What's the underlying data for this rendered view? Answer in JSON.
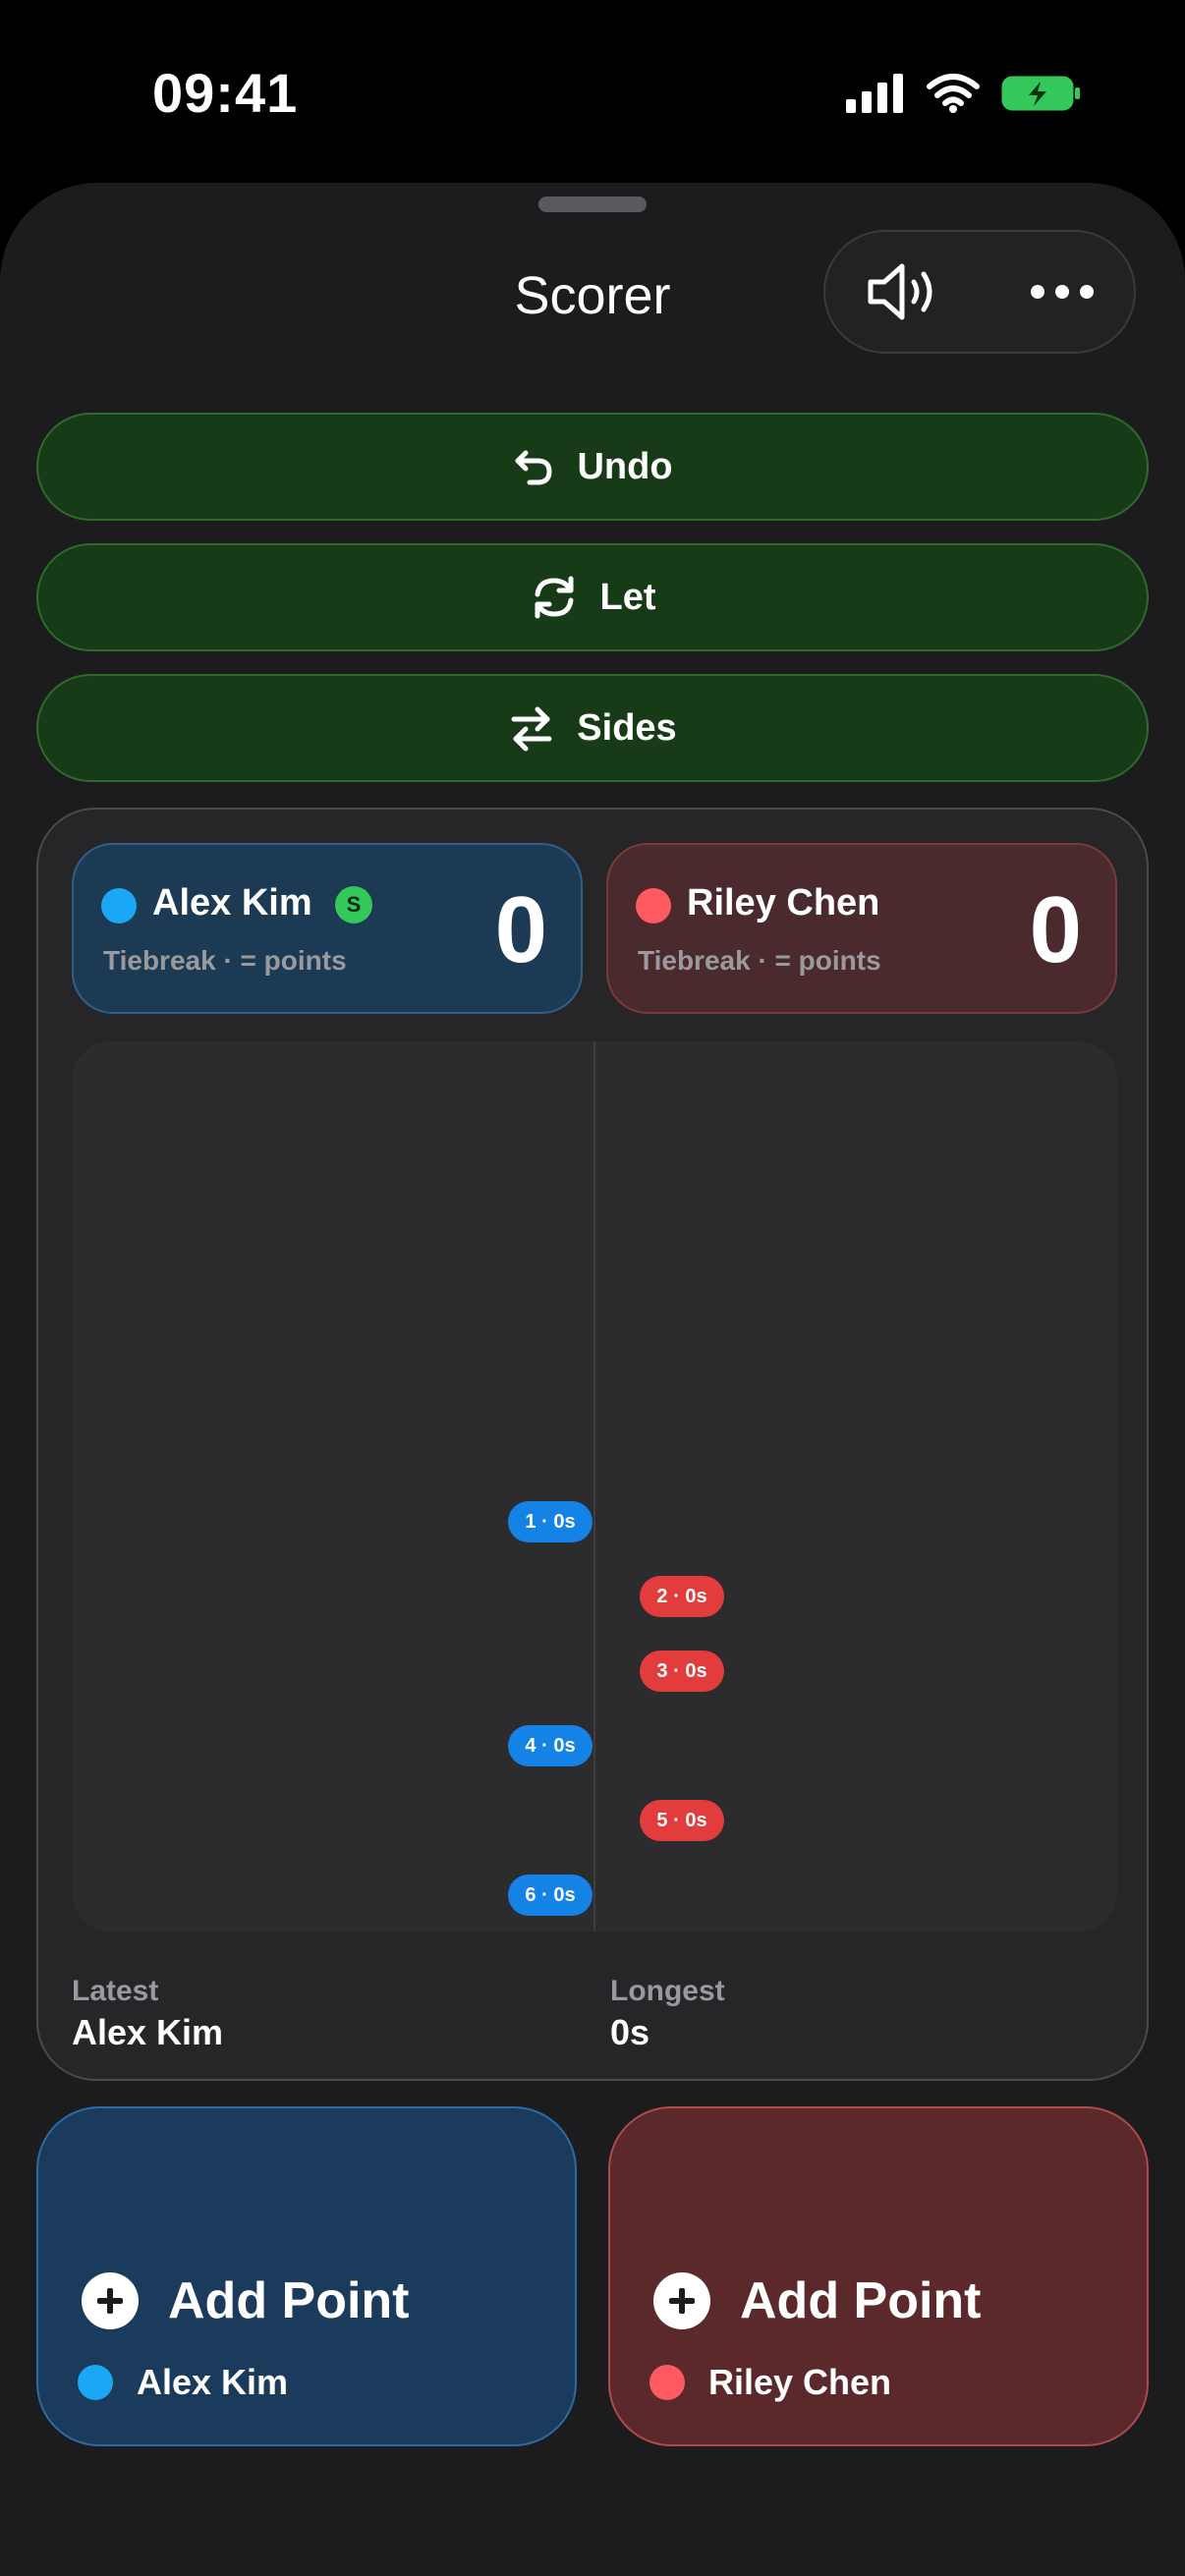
{
  "status": {
    "time": "09:41"
  },
  "header": {
    "title": "Scorer"
  },
  "actions": [
    {
      "label": "Undo",
      "icon": "undo-icon"
    },
    {
      "label": "Let",
      "icon": "refresh-icon"
    },
    {
      "label": "Sides",
      "icon": "swap-icon"
    }
  ],
  "players": [
    {
      "name": "Alex Kim",
      "subtitle": "Tiebreak · = points",
      "score": "0",
      "color": "#1aa7f5",
      "serving_badge": "S"
    },
    {
      "name": "Riley Chen",
      "subtitle": "Tiebreak · = points",
      "score": "0",
      "color": "#ff5a5f"
    }
  ],
  "timeline": {
    "rallies": [
      {
        "label": "1 · 0s",
        "side": "blue"
      },
      {
        "label": "2 · 0s",
        "side": "red"
      },
      {
        "label": "3 · 0s",
        "side": "red"
      },
      {
        "label": "4 · 0s",
        "side": "blue"
      },
      {
        "label": "5 · 0s",
        "side": "red"
      },
      {
        "label": "6 · 0s",
        "side": "blue"
      }
    ]
  },
  "stats": {
    "latest_label": "Latest",
    "latest_value": "Alex Kim",
    "longest_label": "Longest",
    "longest_value": "0s"
  },
  "add_point": {
    "label": "Add Point"
  },
  "colors": {
    "accent_green": "#173b17",
    "blue": "#1583e6",
    "red": "#e23c3c"
  }
}
